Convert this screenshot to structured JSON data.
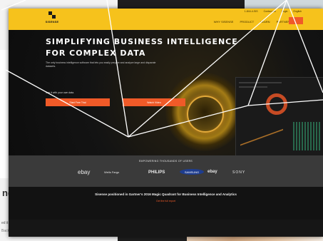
{
  "background": {
    "left_heading": "nd",
    "left_small_1": "ed it",
    "left_small_2": "Back to all pos"
  },
  "site": {
    "logo_text": "SISENSE",
    "top_links": [
      "1-844-4-SIS",
      "Contact Us",
      "Login",
      "English"
    ],
    "nav_items": [
      "WHY SISENSE",
      "PRODUCT",
      "LEARN",
      "PARTNERS"
    ],
    "hero": {
      "title_line_1": "SIMPLIFYING BUSINESS INTELLIGENCE",
      "title_line_2": "FOR COMPLEX DATA",
      "subtitle": "The only business intelligence software that lets you easily prepare and analyze large and disparate datasets.",
      "note": "See it with your own data.",
      "button_1": "Start Free Trial",
      "button_2": "Watch Video"
    },
    "logos": {
      "title": "EMPOWERING THOUSANDS OF USERS",
      "brands": [
        "ebay",
        "Wells Fargo",
        "PHILIPS",
        "SAMSUNG",
        "ebay",
        "SONY"
      ]
    },
    "gartner": {
      "text": "Sisense positioned in Gartner's 2016 Magic Quadrant for Business Intelligence and Analytics",
      "link": "Get the full report"
    }
  },
  "colors": {
    "brand_yellow": "#f6c21c",
    "accent_orange": "#f05a28",
    "dark_bg": "#161616",
    "logo_band": "#3a3a3a",
    "overlay_line": "#ffffff"
  }
}
